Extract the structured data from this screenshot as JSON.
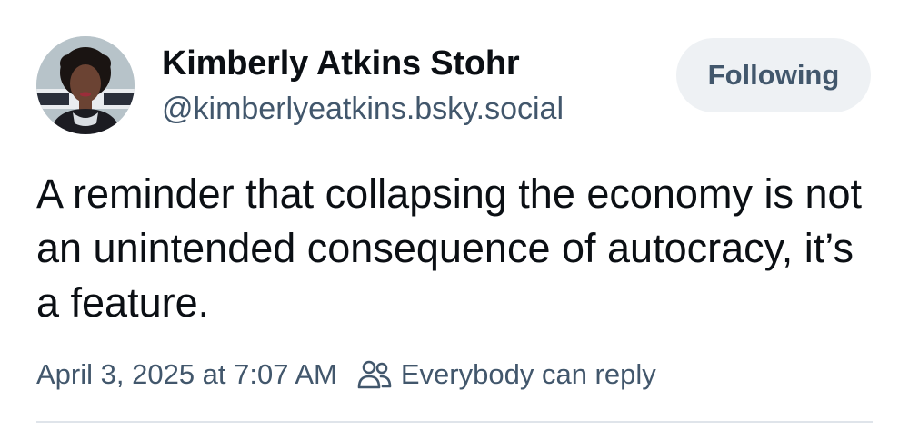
{
  "post": {
    "author": {
      "display_name": "Kimberly Atkins Stohr",
      "handle": "@kimberlyeatkins.bsky.social",
      "avatar_icon": "profile-photo"
    },
    "follow_button_label": "Following",
    "text": "A reminder that collapsing the economy is not an unintended consequence of autocracy, it’s a feature.",
    "timestamp": "April 3, 2025 at 7:07 AM",
    "reply_setting": {
      "icon": "people-icon",
      "label": "Everybody can reply"
    }
  },
  "colors": {
    "text_primary": "#0b0f14",
    "text_secondary": "#42576c",
    "button_bg": "#eef1f4",
    "divider": "#dfe4ea"
  }
}
